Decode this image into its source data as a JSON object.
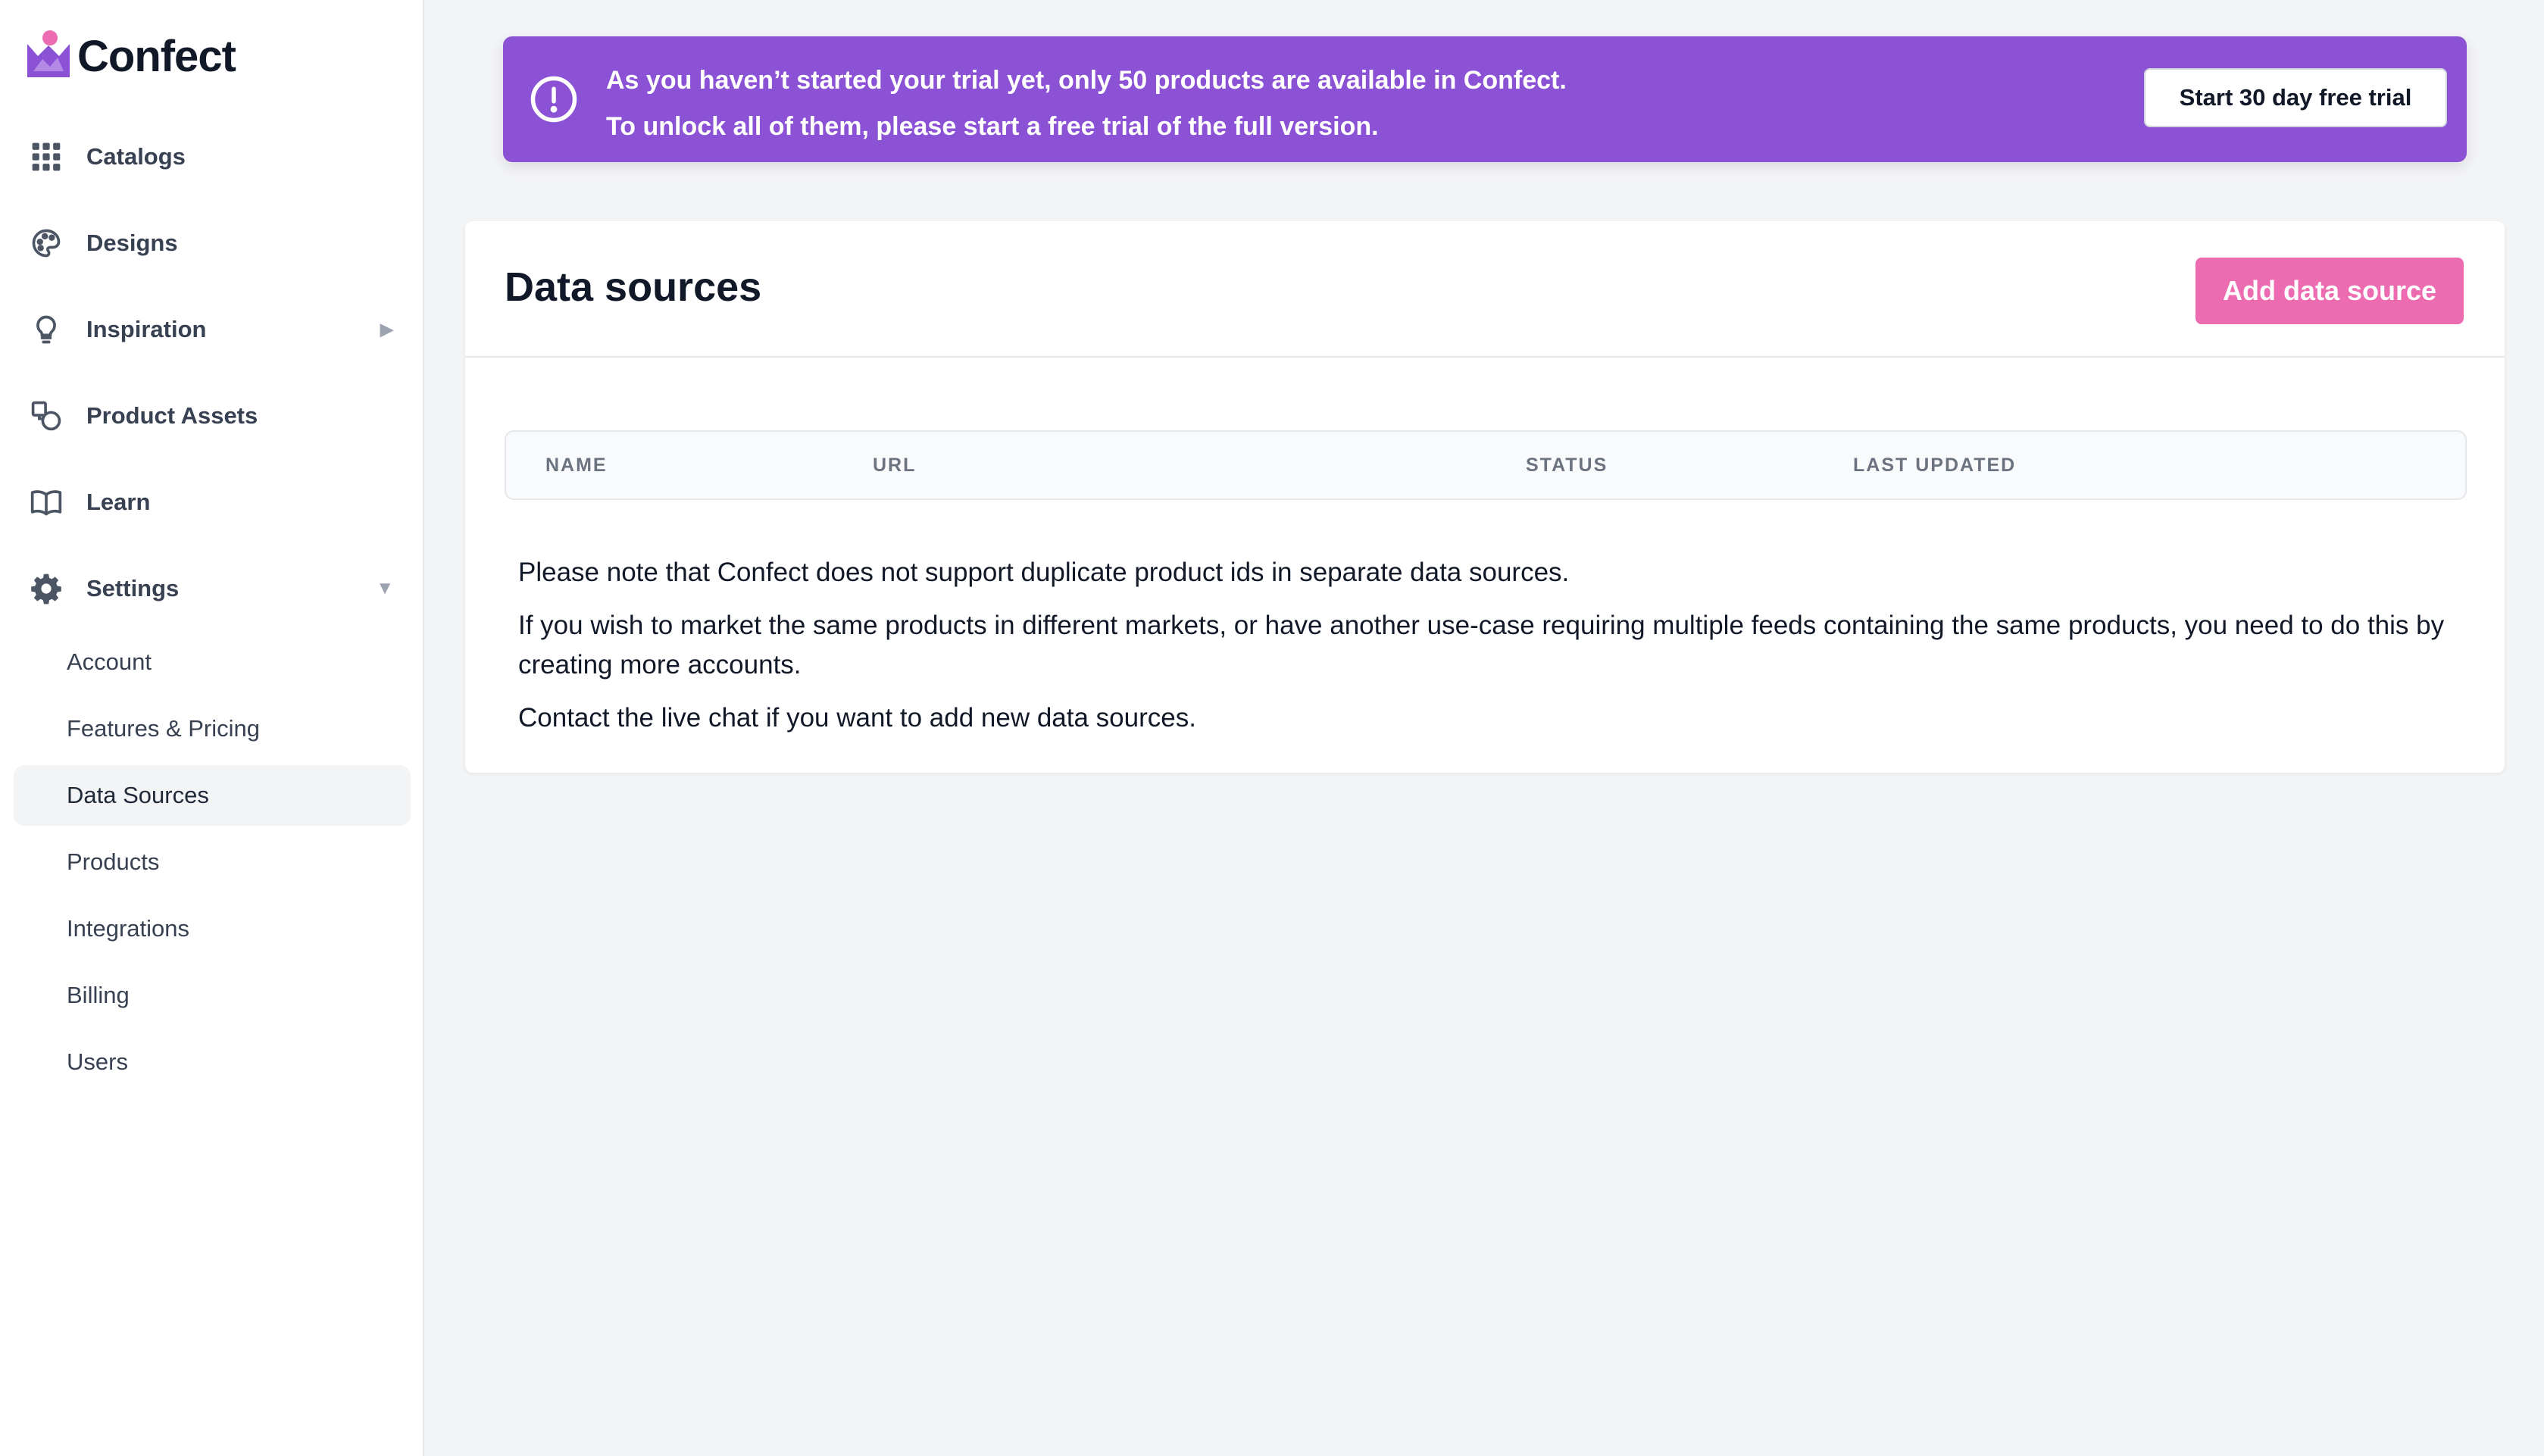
{
  "app": {
    "name": "Confect"
  },
  "sidebar": {
    "items": [
      {
        "label": "Catalogs",
        "icon": "grid-icon"
      },
      {
        "label": "Designs",
        "icon": "palette-icon"
      },
      {
        "label": "Inspiration",
        "icon": "lightbulb-icon",
        "arrow": "▶"
      },
      {
        "label": "Product Assets",
        "icon": "shapes-icon"
      },
      {
        "label": "Learn",
        "icon": "book-icon"
      },
      {
        "label": "Settings",
        "icon": "gear-icon",
        "arrow": "▼"
      }
    ],
    "settings_subitems": [
      {
        "label": "Account",
        "active": false
      },
      {
        "label": "Features & Pricing",
        "active": false
      },
      {
        "label": "Data Sources",
        "active": true
      },
      {
        "label": "Products",
        "active": false
      },
      {
        "label": "Integrations",
        "active": false
      },
      {
        "label": "Billing",
        "active": false
      },
      {
        "label": "Users",
        "active": false
      }
    ]
  },
  "banner": {
    "line1": "As you haven’t started your trial yet, only 50 products are available in Confect.",
    "line2": "To unlock all of them, please start a free trial of the full version.",
    "button_label": "Start 30 day free trial",
    "color": "#8c52d6"
  },
  "main": {
    "title": "Data sources",
    "add_button_label": "Add data source",
    "add_button_color": "#ec6bb1",
    "table": {
      "columns": [
        "NAME",
        "URL",
        "STATUS",
        "LAST UPDATED"
      ]
    },
    "notes": [
      "Please note that Confect does not support duplicate product ids in separate data sources.",
      "If you wish to market the same products in different markets, or have another use-case requiring multiple feeds containing the same products, you need to do this by creating more accounts.",
      "Contact the live chat if you want to add new data sources."
    ]
  }
}
